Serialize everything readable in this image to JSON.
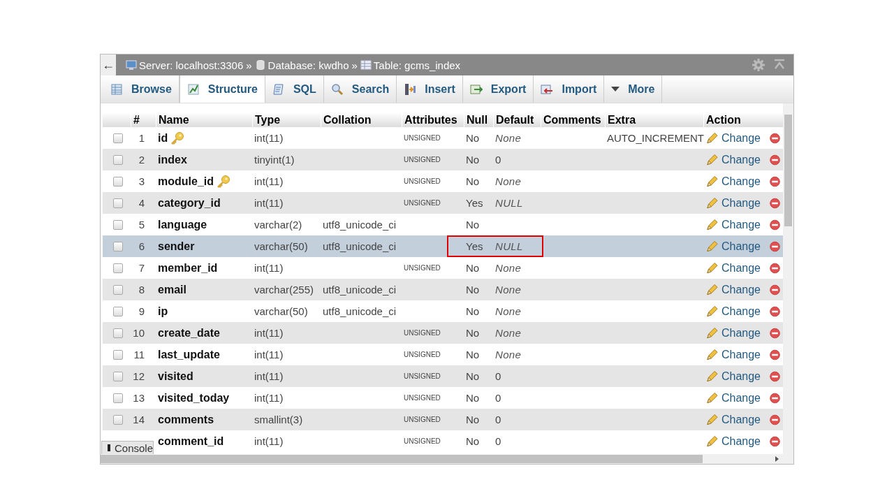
{
  "topbar": {
    "back": "←",
    "breadcrumb": [
      {
        "kind": "server",
        "text": "Server: localhost:3306"
      },
      {
        "kind": "sep",
        "text": "»"
      },
      {
        "kind": "database",
        "text": "Database: kwdho"
      },
      {
        "kind": "sep",
        "text": "»"
      },
      {
        "kind": "table",
        "text": "Table: gcms_index"
      }
    ]
  },
  "tabs": [
    {
      "kind": "browse",
      "label": "Browse",
      "selected": false
    },
    {
      "kind": "structure",
      "label": "Structure",
      "selected": true
    },
    {
      "kind": "sql",
      "label": "SQL",
      "selected": false
    },
    {
      "kind": "search",
      "label": "Search",
      "selected": false
    },
    {
      "kind": "insert",
      "label": "Insert",
      "selected": false
    },
    {
      "kind": "export",
      "label": "Export",
      "selected": false
    },
    {
      "kind": "import",
      "label": "Import",
      "selected": false
    },
    {
      "kind": "more",
      "label": "More",
      "selected": false
    }
  ],
  "columns": [
    "#",
    "Name",
    "Type",
    "Collation",
    "Attributes",
    "Null",
    "Default",
    "Comments",
    "Extra",
    "Action"
  ],
  "rows": [
    {
      "num": "1",
      "name": "id",
      "key": true,
      "type": "int(11)",
      "collation": "",
      "attributes": "UNSIGNED",
      "null": "No",
      "default": "None",
      "default_italic": true,
      "extra": "AUTO_INCREMENT",
      "action": "Change",
      "checked": false,
      "highlighted": false,
      "boxed": false
    },
    {
      "num": "2",
      "name": "index",
      "key": false,
      "type": "tinyint(1)",
      "collation": "",
      "attributes": "UNSIGNED",
      "null": "No",
      "default": "0",
      "default_italic": false,
      "extra": "",
      "action": "Change",
      "checked": false,
      "highlighted": false,
      "boxed": false
    },
    {
      "num": "3",
      "name": "module_id",
      "key": true,
      "type": "int(11)",
      "collation": "",
      "attributes": "UNSIGNED",
      "null": "No",
      "default": "None",
      "default_italic": true,
      "extra": "",
      "action": "Change",
      "checked": false,
      "highlighted": false,
      "boxed": false
    },
    {
      "num": "4",
      "name": "category_id",
      "key": false,
      "type": "int(11)",
      "collation": "",
      "attributes": "UNSIGNED",
      "null": "Yes",
      "default": "NULL",
      "default_italic": true,
      "extra": "",
      "action": "Change",
      "checked": false,
      "highlighted": false,
      "boxed": false
    },
    {
      "num": "5",
      "name": "language",
      "key": false,
      "type": "varchar(2)",
      "collation": "utf8_unicode_ci",
      "attributes": "",
      "null": "No",
      "extra": "",
      "action": "Change",
      "checked": false,
      "highlighted": false,
      "boxed": false
    },
    {
      "num": "6",
      "name": "sender",
      "key": false,
      "type": "varchar(50)",
      "collation": "utf8_unicode_ci",
      "attributes": "",
      "null": "Yes",
      "default": "NULL",
      "default_italic": true,
      "extra": "",
      "action": "Change",
      "checked": false,
      "highlighted": true,
      "boxed": true
    },
    {
      "num": "7",
      "name": "member_id",
      "key": false,
      "type": "int(11)",
      "collation": "",
      "attributes": "UNSIGNED",
      "null": "No",
      "default": "None",
      "default_italic": true,
      "extra": "",
      "action": "Change",
      "checked": false,
      "highlighted": false,
      "boxed": false
    },
    {
      "num": "8",
      "name": "email",
      "key": false,
      "type": "varchar(255)",
      "collation": "utf8_unicode_ci",
      "attributes": "",
      "null": "No",
      "default": "None",
      "default_italic": true,
      "extra": "",
      "action": "Change",
      "checked": false,
      "highlighted": false,
      "boxed": false
    },
    {
      "num": "9",
      "name": "ip",
      "key": false,
      "type": "varchar(50)",
      "collation": "utf8_unicode_ci",
      "attributes": "",
      "null": "No",
      "default": "None",
      "default_italic": true,
      "extra": "",
      "action": "Change",
      "checked": false,
      "highlighted": false,
      "boxed": false
    },
    {
      "num": "10",
      "name": "create_date",
      "key": false,
      "type": "int(11)",
      "collation": "",
      "attributes": "UNSIGNED",
      "null": "No",
      "default": "None",
      "default_italic": true,
      "extra": "",
      "action": "Change",
      "checked": false,
      "highlighted": false,
      "boxed": false
    },
    {
      "num": "11",
      "name": "last_update",
      "key": false,
      "type": "int(11)",
      "collation": "",
      "attributes": "UNSIGNED",
      "null": "No",
      "default": "None",
      "default_italic": true,
      "extra": "",
      "action": "Change",
      "checked": false,
      "highlighted": false,
      "boxed": false
    },
    {
      "num": "12",
      "name": "visited",
      "key": false,
      "type": "int(11)",
      "collation": "",
      "attributes": "UNSIGNED",
      "null": "No",
      "default": "0",
      "default_italic": false,
      "extra": "",
      "action": "Change",
      "checked": false,
      "highlighted": false,
      "boxed": false
    },
    {
      "num": "13",
      "name": "visited_today",
      "key": false,
      "type": "int(11)",
      "collation": "",
      "attributes": "UNSIGNED",
      "null": "No",
      "default": "0",
      "default_italic": false,
      "extra": "",
      "action": "Change",
      "checked": false,
      "highlighted": false,
      "boxed": false
    },
    {
      "num": "14",
      "name": "comments",
      "key": false,
      "type": "smallint(3)",
      "collation": "",
      "attributes": "UNSIGNED",
      "null": "No",
      "default": "0",
      "default_italic": false,
      "extra": "",
      "action": "Change",
      "checked": false,
      "highlighted": false,
      "boxed": false
    },
    {
      "name": "comment_id",
      "key": false,
      "type": "int(11)",
      "collation": "",
      "attributes": "UNSIGNED",
      "null": "No",
      "default": "0",
      "default_italic": false,
      "extra": "",
      "action": "Change",
      "highlighted": false,
      "boxed": false
    }
  ],
  "console": {
    "label": "Console"
  }
}
